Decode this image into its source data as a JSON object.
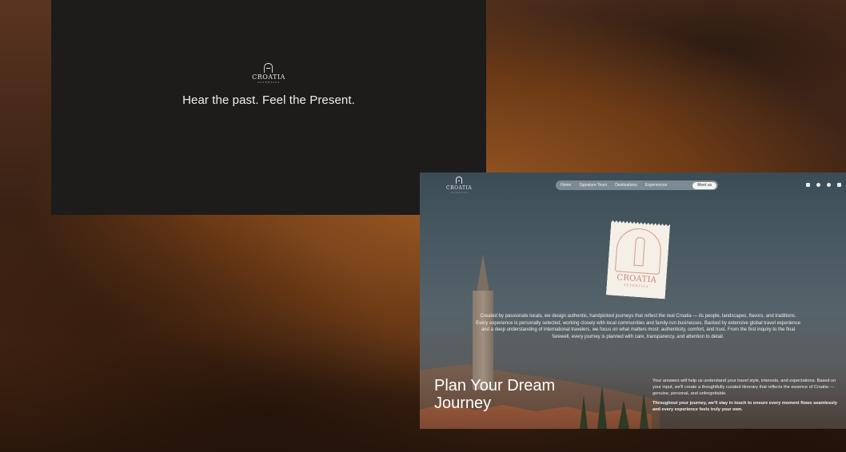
{
  "left_panel": {
    "logo_word": "CROATIA",
    "logo_sub": "AUTENTICA",
    "tagline": "Hear the past. Feel the Present."
  },
  "site": {
    "logo_word": "CROATIA",
    "logo_sub": "AUTENTICA",
    "nav": [
      "Home",
      "Signature Tours",
      "Destinations",
      "Experiences",
      "Meet us"
    ],
    "nav_active": "Meet us",
    "social_icons": [
      "mail-icon",
      "whatsapp-icon",
      "phone-icon",
      "instagram-icon"
    ],
    "stamp_word": "CROATIA",
    "stamp_sub": "AUTENTICA",
    "intro": "Created by passionate locals, we design authentic, handpicked journeys that reflect the real Croatia — its people, landscapes, flavors, and traditions. Every experience is personally selected, working closely with local communities and family-run businesses. Backed by extensive global travel experience and a deep understanding of international travelers, we focus on what matters most: authenticity, comfort, and trust. From the first inquiry to the final farewell, every journey is planned with care, transparency, and attention to detail.",
    "plan_title_line1": "Plan Your Dream",
    "plan_title_line2": "Journey",
    "side_text_1": "Your answers will help us understand your travel style, interests, and expectations. Based on your input, we'll create a thoughtfully curated itinerary that reflects the essence of Croatia — genuine, personal, and unforgettable.",
    "side_text_2": "Throughout your journey, we'll stay in touch to ensure every moment flows seamlessly and every experience feels truly your own."
  },
  "colors": {
    "dark_card": "#1d1c1b",
    "stamp_accent": "#c98574",
    "nav_bg": "#7e8a92"
  }
}
